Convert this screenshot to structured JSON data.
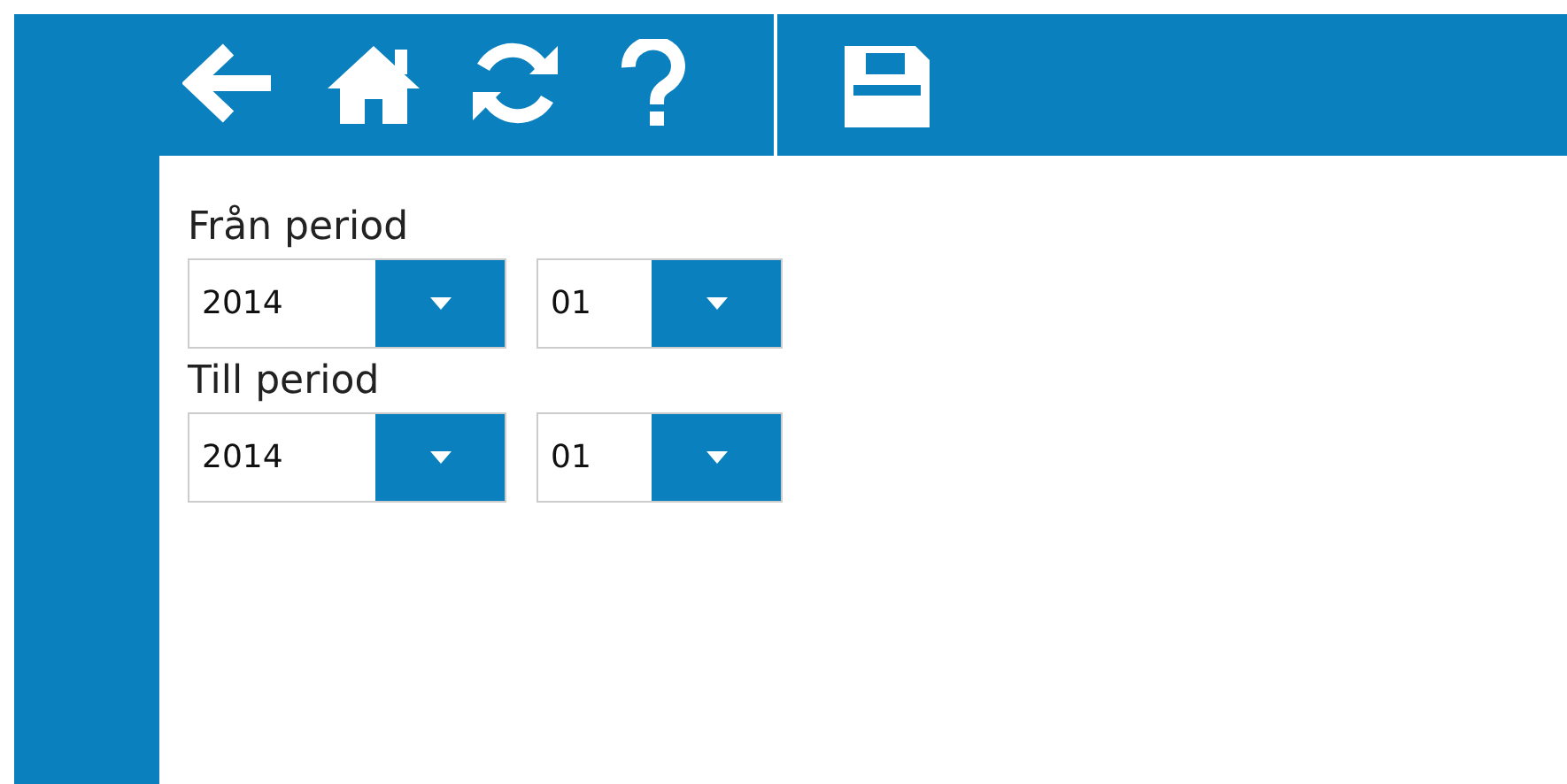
{
  "toolbar": {
    "groups": [
      [
        {
          "kind": "back"
        },
        {
          "kind": "home"
        },
        {
          "kind": "refresh"
        },
        {
          "kind": "help"
        }
      ],
      [
        {
          "kind": "save"
        }
      ]
    ]
  },
  "periods": [
    {
      "label": "Från period",
      "fields": [
        {
          "kind": "year",
          "value": "2014"
        },
        {
          "kind": "month",
          "value": "01"
        }
      ]
    },
    {
      "label": "Till period",
      "fields": [
        {
          "kind": "year",
          "value": "2014"
        },
        {
          "kind": "month",
          "value": "01"
        }
      ]
    }
  ]
}
